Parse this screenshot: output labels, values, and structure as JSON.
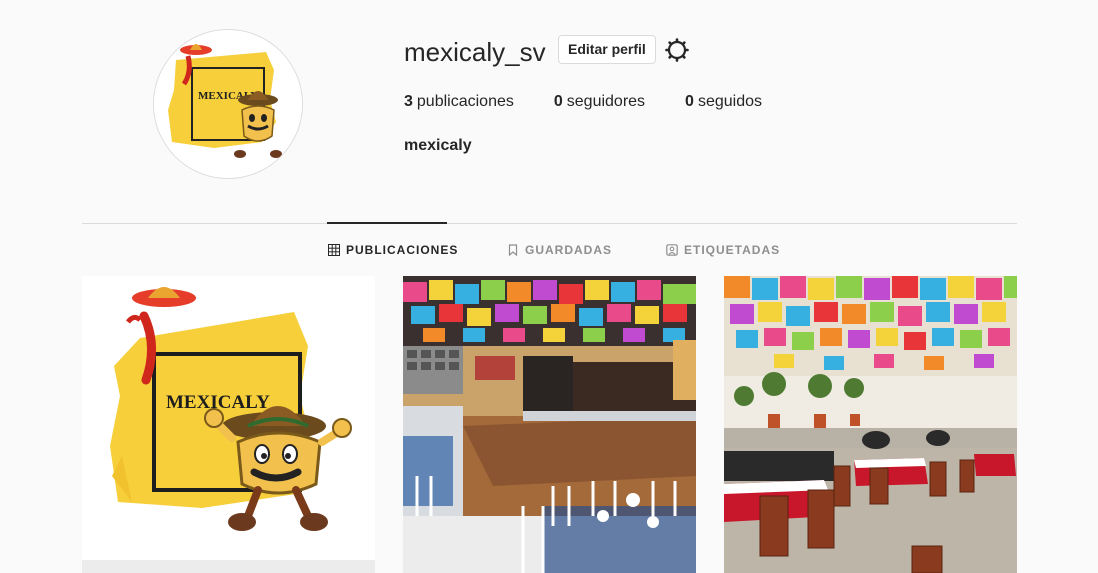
{
  "profile": {
    "username": "mexicaly_sv",
    "edit_label": "Editar perfil",
    "full_name": "mexicaly",
    "logo_text": "MEXICALY"
  },
  "stats": {
    "posts_count": "3",
    "posts_label": "publicaciones",
    "followers_count": "0",
    "followers_label": "seguidores",
    "following_count": "0",
    "following_label": "seguidos"
  },
  "tabs": [
    {
      "label": "PUBLICACIONES",
      "icon": "grid-icon",
      "active": true
    },
    {
      "label": "GUARDADAS",
      "icon": "bookmark-icon",
      "active": false
    },
    {
      "label": "ETIQUETADAS",
      "icon": "tagged-icon",
      "active": false
    }
  ],
  "posts": [
    {
      "kind": "logo"
    },
    {
      "kind": "venue-stage"
    },
    {
      "kind": "venue-patio"
    }
  ],
  "colors": {
    "accent_yellow": "#f7d13b",
    "text": "#262626",
    "muted": "#8e8e8e",
    "border": "#dbdbdb",
    "background": "#fafafa"
  }
}
